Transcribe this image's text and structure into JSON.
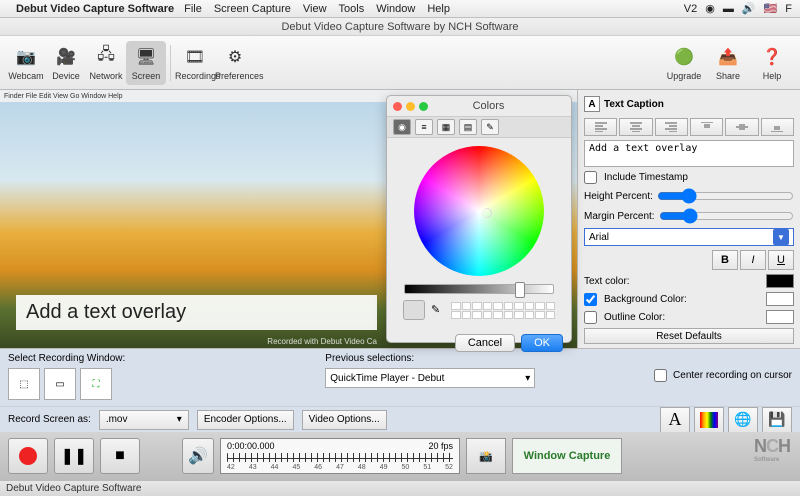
{
  "menubar": {
    "app": "Debut Video Capture Software",
    "items": [
      "File",
      "Screen Capture",
      "View",
      "Tools",
      "Window",
      "Help"
    ]
  },
  "window_title": "Debut Video Capture Software by NCH Software",
  "toolbar": {
    "left": [
      {
        "label": "Webcam",
        "icon": "📷"
      },
      {
        "label": "Device",
        "icon": "🎥"
      },
      {
        "label": "Network",
        "icon": "🖧"
      },
      {
        "label": "Screen",
        "icon": "🖥",
        "active": true
      },
      {
        "label": "Recordings",
        "icon": "🎞"
      },
      {
        "label": "Preferences",
        "icon": "⚙"
      }
    ],
    "right": [
      {
        "label": "Upgrade",
        "icon": "🟢"
      },
      {
        "label": "Share",
        "icon": "📤"
      },
      {
        "label": "Help",
        "icon": "❓"
      }
    ]
  },
  "preview": {
    "overlay": "Add a text overlay",
    "watermark": "Recorded with Debut Video Ca",
    "inner_menubar": "  Finder  File  Edit  View  Go  Window  Help"
  },
  "color_picker": {
    "title": "Colors",
    "cancel": "Cancel",
    "ok": "OK"
  },
  "sidebar": {
    "title": "Text Caption",
    "textarea": "Add a text overlay",
    "include_timestamp": "Include Timestamp",
    "height_label": "Height Percent:",
    "margin_label": "Margin Percent:",
    "font": "Arial",
    "text_color_label": "Text color:",
    "bg_color_label": "Background Color:",
    "outline_label": "Outline Color:",
    "reset": "Reset Defaults",
    "text_color": "#000000",
    "bg_color": "#ffffff",
    "outline_color": "#ffffff"
  },
  "panel_a": {
    "select_label": "Select Recording Window:",
    "prev_label": "Previous selections:",
    "prev_value": "QuickTime Player - Debut",
    "center_label": "Center recording on cursor"
  },
  "panel_b": {
    "record_as": "Record Screen as:",
    "format": ".mov",
    "encoder": "Encoder Options...",
    "video": "Video Options..."
  },
  "transport": {
    "time": "0:00:00.000",
    "fps": "20 fps",
    "ticks": [
      "42",
      "43",
      "44",
      "45",
      "46",
      "47",
      "48",
      "49",
      "50",
      "51",
      "52"
    ],
    "mode": "Window Capture"
  },
  "nch": {
    "brand": "NCH",
    "sub": "Software"
  },
  "status": "Debut Video Capture Software"
}
